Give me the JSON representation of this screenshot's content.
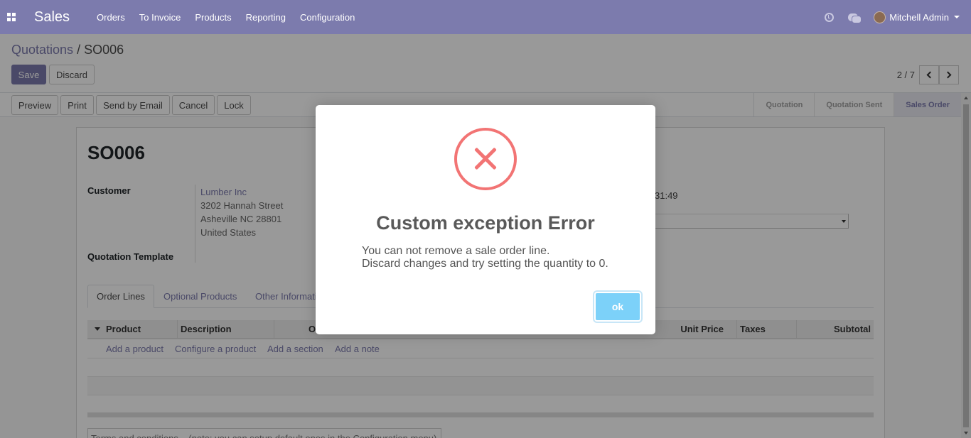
{
  "navbar": {
    "app_name": "Sales",
    "menu": [
      "Orders",
      "To Invoice",
      "Products",
      "Reporting",
      "Configuration"
    ],
    "user_name": "Mitchell Admin",
    "color": "#7c7bad"
  },
  "control_panel": {
    "breadcrumb_parent": "Quotations",
    "breadcrumb_sep": " / ",
    "breadcrumb_current": "SO006",
    "save_label": "Save",
    "discard_label": "Discard",
    "pager": "2 / 7"
  },
  "statusbar": {
    "buttons": [
      "Preview",
      "Print",
      "Send by Email",
      "Cancel",
      "Lock"
    ],
    "stages": [
      "Quotation",
      "Quotation Sent",
      "Sales Order"
    ],
    "active_stage": "Sales Order"
  },
  "form": {
    "title": "SO006",
    "customer_label": "Customer",
    "customer_address": [
      "Lumber Inc",
      "3202 Hannah Street",
      "Asheville NC 28801",
      "United States"
    ],
    "quotation_template_label": "Quotation Template",
    "date_fragment": "31:49",
    "tabs": [
      "Order Lines",
      "Optional Products",
      "Other Informati"
    ],
    "columns": [
      "Product",
      "Description",
      "O",
      "Unit Price",
      "Taxes",
      "Subtotal"
    ],
    "add_links": [
      "Add a product",
      "Configure a product",
      "Add a section",
      "Add a note"
    ],
    "terms_placeholder": "Terms and conditions... (note: you can setup default ones in the Configuration menu)"
  },
  "modal": {
    "title": "Custom exception Error",
    "line1": "You can not remove a sale order line.",
    "line2": "Discard changes and try setting the quantity to 0.",
    "ok_label": "ok",
    "icon": "error-x-icon",
    "icon_color": "#f27474",
    "ok_color": "#7cd1f9"
  }
}
